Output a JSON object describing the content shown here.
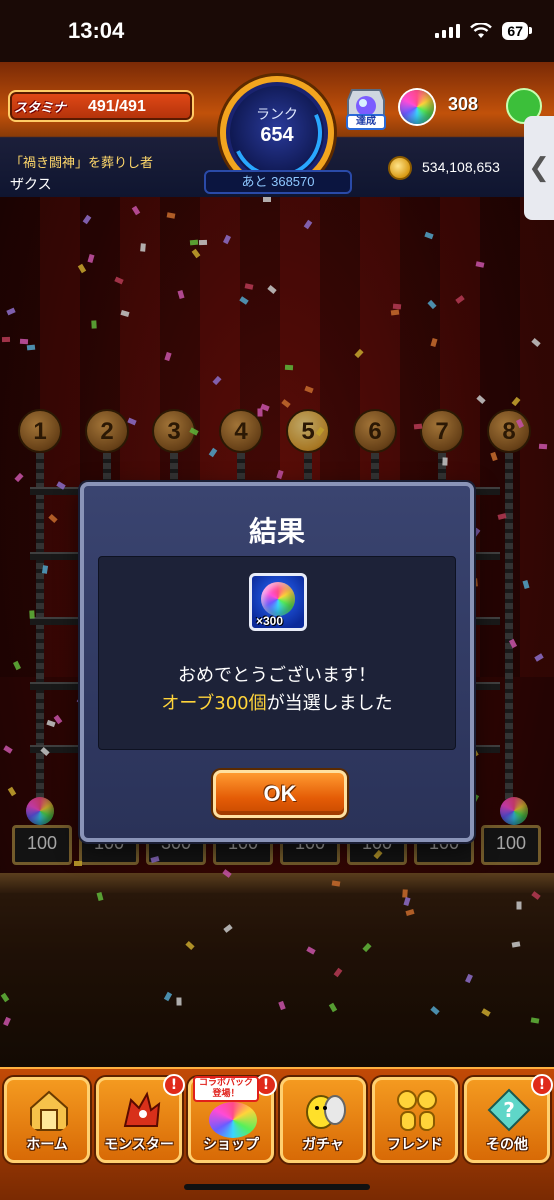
{
  "statusbar": {
    "time": "13:04",
    "battery": "67"
  },
  "hud": {
    "stamina_label": "スタミナ",
    "stamina_value": "491/491",
    "rank_label": "ランク",
    "rank_value": "654",
    "rank_next": "あと 368570",
    "achievement_label": "達成",
    "orb_count": "308",
    "player_title": "「禍き闘神」を葬りし者",
    "player_name": "ザクス",
    "gold": "534,108,653"
  },
  "stage": {
    "slots": [
      "1",
      "2",
      "3",
      "4",
      "5",
      "6",
      "7",
      "8"
    ],
    "prizes": [
      "100",
      "100",
      "300",
      "100",
      "100",
      "100",
      "100",
      "100"
    ]
  },
  "dialog": {
    "title": "結果",
    "reward_qty": "×300",
    "message_line1": "おめでとうございます！",
    "message_highlight": "オーブ300個",
    "message_rest": "が当選しました",
    "ok_label": "OK"
  },
  "nav": {
    "items": [
      {
        "label": "ホーム",
        "icon": "home-icon"
      },
      {
        "label": "モンスター",
        "icon": "monster-icon"
      },
      {
        "label": "ショップ",
        "icon": "shop-icon"
      },
      {
        "label": "ガチャ",
        "icon": "gacha-icon"
      },
      {
        "label": "フレンド",
        "icon": "friend-icon"
      },
      {
        "label": "その他",
        "icon": "other-icon"
      }
    ],
    "collab_tag": "コラボパック 登場！",
    "badge": "!"
  },
  "colors": {
    "accent_orange": "#e45c06",
    "dialog_bg": "#2a3258",
    "highlight_yellow": "#ffd43a"
  }
}
